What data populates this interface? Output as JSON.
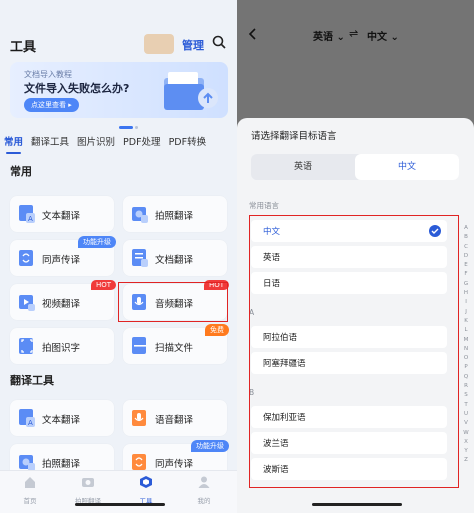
{
  "left": {
    "header": {
      "title": "工具",
      "manage": "管理"
    },
    "banner": {
      "subtitle": "文档导入教程",
      "title": "文件导入失败怎么办?",
      "button": "点这里查看 ▸"
    },
    "tabs": [
      "常用",
      "翻译工具",
      "图片识别",
      "PDF处理",
      "PDF转换"
    ],
    "sections": {
      "common": "常用",
      "translate_tools": "翻译工具"
    },
    "cards": [
      {
        "label": "文本翻译",
        "badge": ""
      },
      {
        "label": "拍照翻译",
        "badge": ""
      },
      {
        "label": "同声传译",
        "badge": "功能升级"
      },
      {
        "label": "文档翻译",
        "badge": ""
      },
      {
        "label": "视频翻译",
        "badge": "HOT"
      },
      {
        "label": "音频翻译",
        "badge": "HOT"
      },
      {
        "label": "拍图识字",
        "badge": ""
      },
      {
        "label": "扫描文件",
        "badge": "免费"
      },
      {
        "label": "文本翻译",
        "badge": ""
      },
      {
        "label": "语音翻译",
        "badge": ""
      },
      {
        "label": "拍照翻译",
        "badge": ""
      },
      {
        "label": "同声传译",
        "badge": "功能升级"
      }
    ],
    "nav": [
      {
        "label": "首页",
        "icon": "home-icon"
      },
      {
        "label": "拍照翻译",
        "icon": "camera-icon"
      },
      {
        "label": "工具",
        "icon": "tools-icon"
      },
      {
        "label": "我的",
        "icon": "profile-icon"
      }
    ]
  },
  "right": {
    "source_lang": "英语 ⌄",
    "swap": "⇌",
    "target_lang": "中文 ⌄",
    "sheet_title": "请选择翻译目标语言",
    "segment": {
      "a": "英语",
      "b": "中文"
    },
    "group_common": "常用语言",
    "group_a": "A",
    "group_b": "B",
    "common_langs": [
      "中文",
      "英语",
      "日语"
    ],
    "a_langs": [
      "阿拉伯语",
      "阿塞拜疆语"
    ],
    "b_langs": [
      "保加利亚语",
      "波兰语",
      "波斯语"
    ],
    "alphabet": [
      "A",
      "B",
      "C",
      "D",
      "E",
      "F",
      "G",
      "H",
      "I",
      "J",
      "K",
      "L",
      "M",
      "N",
      "O",
      "P",
      "Q",
      "R",
      "S",
      "T",
      "U",
      "V",
      "W",
      "X",
      "Y",
      "Z"
    ]
  },
  "colors": {
    "accent": "#2b5bd7",
    "hot": "#f03a3a",
    "free": "#ff7a1e",
    "highlight_box": "#e02424"
  }
}
